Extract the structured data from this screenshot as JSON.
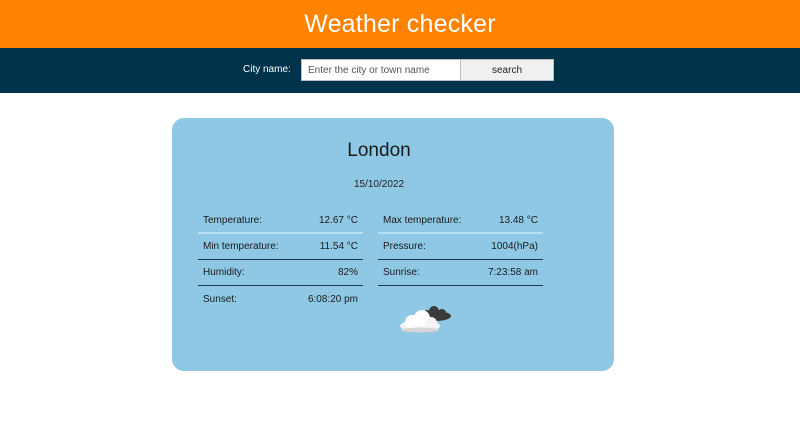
{
  "app": {
    "title": "Weather checker"
  },
  "search": {
    "label": "City name:",
    "placeholder": "Enter the city or town name",
    "value": "",
    "button_label": "search"
  },
  "weather": {
    "city": "London",
    "date": "15/10/2022",
    "left_rows": [
      {
        "label": "Temperature:",
        "value": "12.67 °C"
      },
      {
        "label": "Min temperature:",
        "value": "11.54 °C"
      },
      {
        "label": "Humidity:",
        "value": "82%"
      },
      {
        "label": "Sunset:",
        "value": "6:08:20 pm"
      }
    ],
    "right_rows": [
      {
        "label": "Max temperature:",
        "value": "13.48 °C"
      },
      {
        "label": "Pressure:",
        "value": "1004(hPa)"
      },
      {
        "label": "Sunrise:",
        "value": "7:23:58 am"
      }
    ],
    "icon": "cloudy-icon"
  },
  "colors": {
    "header": "#ff8300",
    "search_bar": "#00324b",
    "card": "#8ec8e5"
  }
}
